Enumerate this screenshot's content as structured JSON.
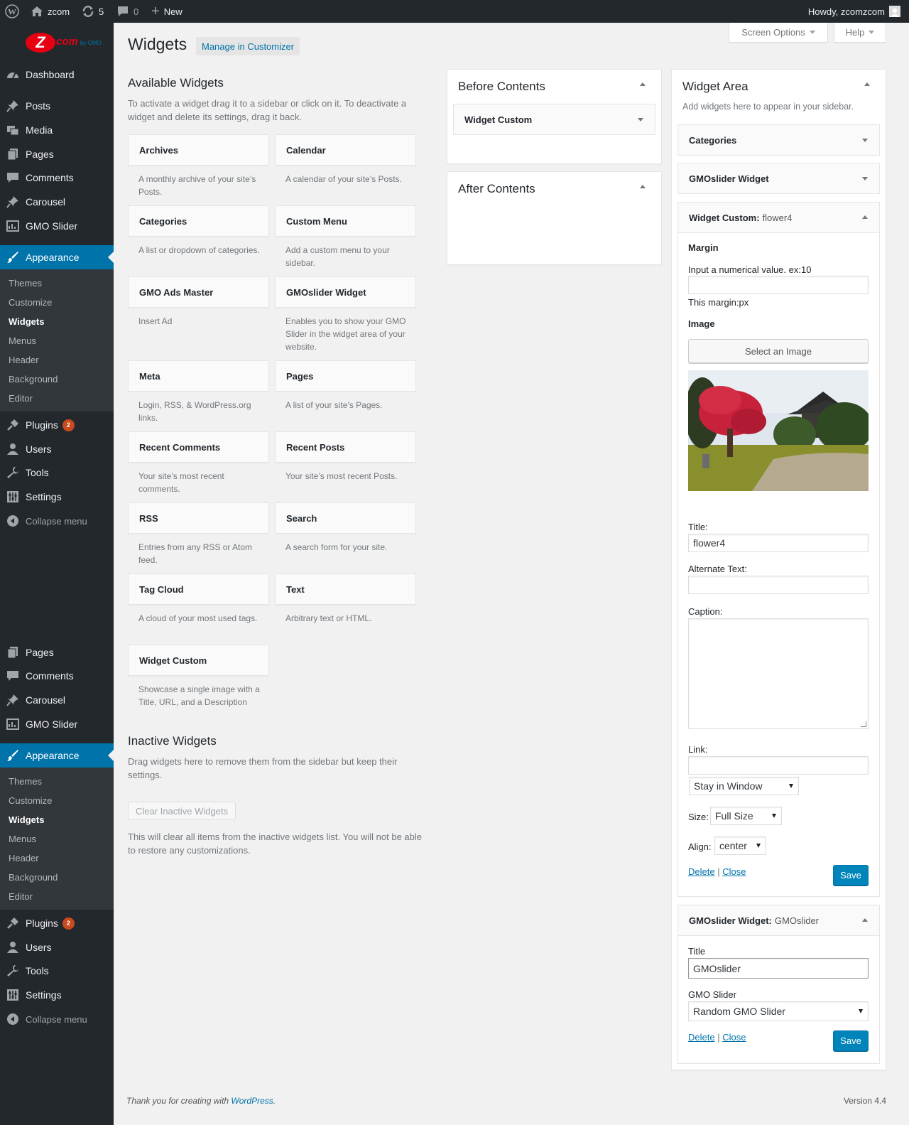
{
  "admin_bar": {
    "site_name": "zcom",
    "updates_count": "5",
    "comments_count": "0",
    "new_label": "New",
    "howdy": "Howdy, zcomzcom"
  },
  "logo": {
    "text": "com",
    "sub": "by GMO",
    "color": "#e60012"
  },
  "menu": {
    "top": [
      "Dashboard"
    ],
    "main": [
      "Posts",
      "Media",
      "Pages",
      "Comments",
      "Carousel",
      "GMO Slider"
    ],
    "appearance": "Appearance",
    "appearance_sub": [
      "Themes",
      "Customize",
      "Widgets",
      "Menus",
      "Header",
      "Background",
      "Editor"
    ],
    "plugins": "Plugins",
    "plugins_badge": "2",
    "rest": [
      "Users",
      "Tools",
      "Settings"
    ],
    "collapse": "Collapse menu",
    "second_main": [
      "Pages",
      "Comments",
      "Carousel",
      "GMO Slider"
    ]
  },
  "header": {
    "screen_options": "Screen Options",
    "help": "Help",
    "title": "Widgets",
    "manage_customizer": "Manage in Customizer"
  },
  "available": {
    "title": "Available Widgets",
    "desc": "To activate a widget drag it to a sidebar or click on it. To deactivate a widget and delete its settings, drag it back.",
    "widgets": [
      {
        "name": "Archives",
        "desc": "A monthly archive of your site’s Posts."
      },
      {
        "name": "Calendar",
        "desc": "A calendar of your site’s Posts."
      },
      {
        "name": "Categories",
        "desc": "A list or dropdown of categories."
      },
      {
        "name": "Custom Menu",
        "desc": "Add a custom menu to your sidebar."
      },
      {
        "name": "GMO Ads Master",
        "desc": "Insert Ad"
      },
      {
        "name": "GMOslider Widget",
        "desc": "Enables you to show your GMO Slider in the widget area of your website."
      },
      {
        "name": "Meta",
        "desc": "Login, RSS, & WordPress.org links."
      },
      {
        "name": "Pages",
        "desc": "A list of your site’s Pages."
      },
      {
        "name": "Recent Comments",
        "desc": "Your site’s most recent comments."
      },
      {
        "name": "Recent Posts",
        "desc": "Your site’s most recent Posts."
      },
      {
        "name": "RSS",
        "desc": "Entries from any RSS or Atom feed."
      },
      {
        "name": "Search",
        "desc": "A search form for your site."
      },
      {
        "name": "Tag Cloud",
        "desc": "A cloud of your most used tags."
      },
      {
        "name": "Text",
        "desc": "Arbitrary text or HTML."
      },
      {
        "name": "Widget Custom",
        "desc": "Showcase a single image with a Title, URL, and a Description"
      }
    ]
  },
  "inactive": {
    "title": "Inactive Widgets",
    "desc": "Drag widgets here to remove them from the sidebar but keep their settings.",
    "clear_button": "Clear Inactive Widgets",
    "note": "This will clear all items from the inactive widgets list. You will not be able to restore any customizations."
  },
  "before_contents": {
    "title": "Before Contents",
    "widget": "Widget Custom"
  },
  "after_contents": {
    "title": "After Contents"
  },
  "widget_area": {
    "title": "Widget Area",
    "desc": "Add widgets here to appear in your sidebar.",
    "w_categories": "Categories",
    "w_gmoslider": "GMOslider Widget",
    "wc": {
      "title_prefix": "Widget Custom:",
      "title_suffix": "flower4",
      "margin_label": "Margin",
      "margin_hint": "Input a numerical value. ex:10",
      "margin_value": "",
      "margin_unit": "This margin:px",
      "image_label": "Image",
      "select_image": "Select an Image",
      "title_label": "Title:",
      "title_value": "flower4",
      "alt_label": "Alternate Text:",
      "alt_value": "",
      "caption_label": "Caption:",
      "link_label": "Link:",
      "link_value": "",
      "target_value": "Stay in Window",
      "size_label": "Size:",
      "size_value": "Full Size",
      "align_label": "Align:",
      "align_value": "center",
      "delete": "Delete",
      "sep": "|",
      "close": "Close",
      "save": "Save"
    },
    "gs": {
      "title_prefix": "GMOslider Widget:",
      "title_suffix": "GMOslider",
      "title_label": "Title",
      "title_value": "GMOslider",
      "slider_label": "GMO Slider",
      "slider_value": "Random GMO Slider",
      "delete": "Delete",
      "sep": "|",
      "close": "Close",
      "save": "Save"
    }
  },
  "footer": {
    "thanks_prefix": "Thank you for creating with ",
    "thanks_link": "WordPress",
    "thanks_suffix": ".",
    "version": "Version 4.4"
  },
  "colors": {
    "admin_bg": "#23282d",
    "accent": "#0073aa",
    "button": "#0085ba",
    "badge": "#ca4a1f"
  }
}
